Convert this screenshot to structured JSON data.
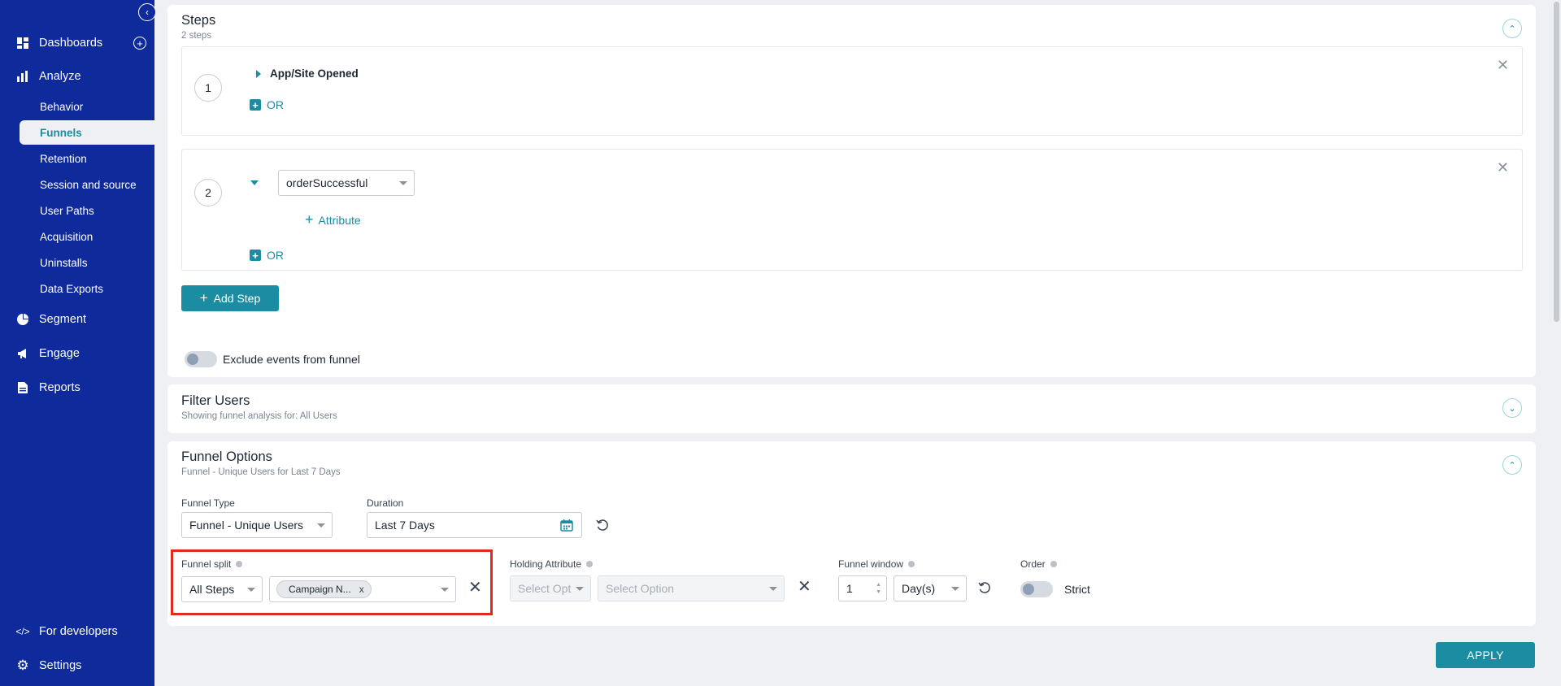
{
  "sidebar": {
    "dashboards": "Dashboards",
    "analyze": "Analyze",
    "analyze_items": [
      "Behavior",
      "Funnels",
      "Retention",
      "Session and source",
      "User Paths",
      "Acquisition",
      "Uninstalls",
      "Data Exports"
    ],
    "segment": "Segment",
    "engage": "Engage",
    "reports": "Reports",
    "for_developers": "For developers",
    "settings": "Settings"
  },
  "steps": {
    "title": "Steps",
    "subtitle": "2 steps",
    "step1": {
      "number": "1",
      "event": "App/Site Opened",
      "or": "OR"
    },
    "step2": {
      "number": "2",
      "event": "orderSuccessful",
      "attribute": "Attribute",
      "or": "OR"
    },
    "add_step": "Add Step",
    "exclude_label": "Exclude events from funnel"
  },
  "filter_users": {
    "title": "Filter Users",
    "subtitle": "Showing funnel analysis for: All Users"
  },
  "funnel_options": {
    "title": "Funnel Options",
    "subtitle": "Funnel - Unique Users for Last 7 Days",
    "funnel_type_label": "Funnel Type",
    "funnel_type_value": "Funnel - Unique Users",
    "duration_label": "Duration",
    "duration_value": "Last 7 Days",
    "funnel_split_label": "Funnel split",
    "funnel_split_value": "All Steps",
    "split_chip": "Campaign N...",
    "holding_attribute_label": "Holding Attribute",
    "holding_select_1": "Select Opt",
    "holding_select_2": "Select Option",
    "funnel_window_label": "Funnel window",
    "funnel_window_value": "1",
    "funnel_window_unit": "Day(s)",
    "order_label": "Order",
    "order_value": "Strict"
  },
  "apply_label": "APPLY",
  "colors": {
    "sidebar": "#0e2a9b",
    "accent": "#1a8da3",
    "highlight": "#e12a1f"
  }
}
